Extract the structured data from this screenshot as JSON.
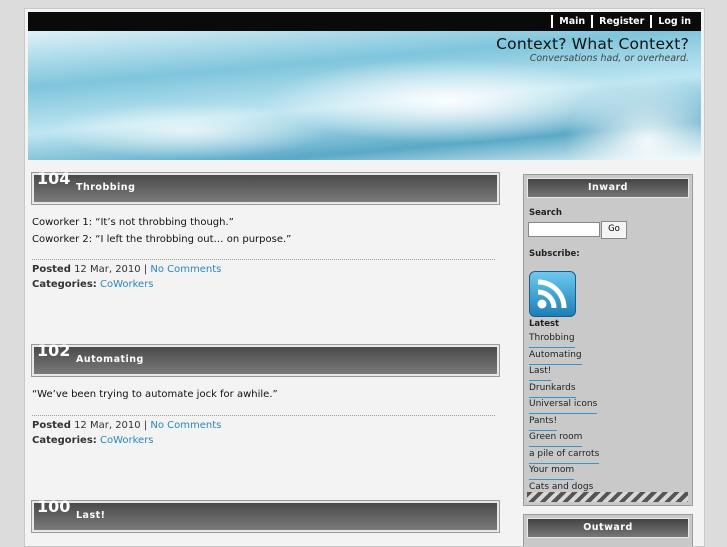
{
  "nav": {
    "main": "Main",
    "register": "Register",
    "login": "Log in"
  },
  "site": {
    "title": "Context? What Context?",
    "subtitle": "Conversations had, or overheard."
  },
  "posts": [
    {
      "num": "104",
      "title": "Throbbing",
      "lines": [
        "Coworker 1: “It’s not throbbing though.”",
        "Coworker 2: “I left the throbbing out… on purpose.”"
      ],
      "posted_label": "Posted",
      "date": "12 Mar, 2010",
      "sep": "|",
      "comments": "No Comments",
      "cat_label": "Categories:",
      "category": "CoWorkers"
    },
    {
      "num": "102",
      "title": "Automating",
      "lines": [
        "“We’ve been trying to automate jock for awhile.”"
      ],
      "posted_label": "Posted",
      "date": "12 Mar, 2010",
      "sep": "|",
      "comments": "No Comments",
      "cat_label": "Categories:",
      "category": "CoWorkers"
    },
    {
      "num": "100",
      "title": "Last!"
    }
  ],
  "sidebar": {
    "inward": "Inward",
    "search_label": "Search",
    "go": "Go",
    "subscribe": "Subscribe:",
    "latest_label": "Latest",
    "latest": [
      "Throbbing",
      "Automating",
      "Last!",
      "Drunkards",
      "Universal icons",
      "Pants!",
      "Green room",
      "a pile of carrots",
      "Your mom",
      "Cats and dogs"
    ],
    "outward": "Outward"
  },
  "colors": {
    "link": "#2a86b8",
    "header_bar": "#0a0a0a"
  }
}
